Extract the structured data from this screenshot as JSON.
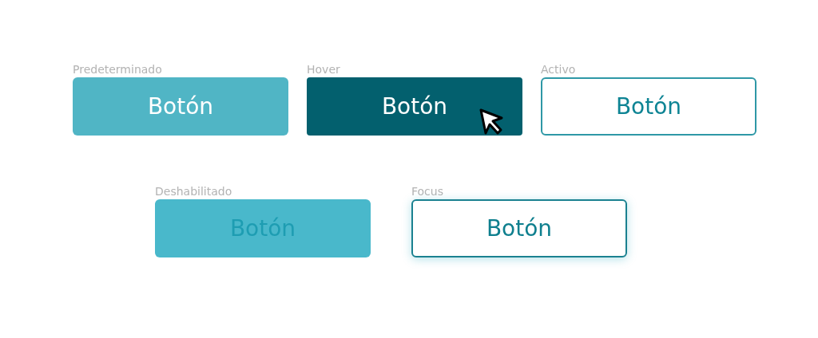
{
  "rows": [
    {
      "buttons": [
        {
          "caption": "Predeterminado",
          "label": "Botón",
          "kind": "default"
        },
        {
          "caption": "Hover",
          "label": "Botón",
          "kind": "hover"
        },
        {
          "caption": "Activo",
          "label": "Botón",
          "kind": "active"
        }
      ]
    },
    {
      "buttons": [
        {
          "caption": "Deshabilitado",
          "label": "Botón",
          "kind": "disabled"
        },
        {
          "caption": "Focus",
          "label": "Botón",
          "kind": "focus"
        }
      ]
    }
  ]
}
